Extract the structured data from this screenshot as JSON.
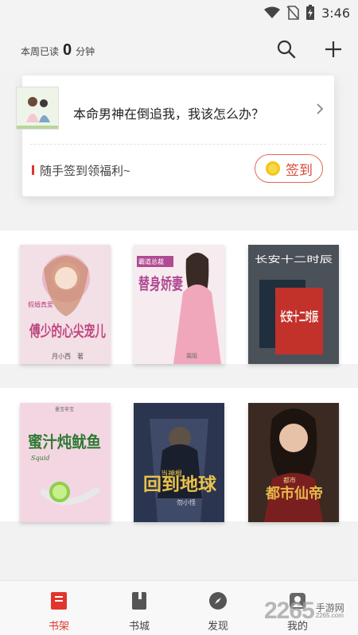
{
  "status_bar": {
    "time": "3:46",
    "icons": [
      "wifi-icon",
      "no-sim-icon",
      "battery-charging-icon"
    ]
  },
  "header": {
    "week_read_prefix": "本周已读",
    "week_read_minutes": "0",
    "week_read_suffix": "分钟",
    "icons": [
      "search-icon",
      "add-icon"
    ]
  },
  "recommendation": {
    "title": "本命男神在倒追我，我该怎么办？"
  },
  "signin": {
    "text": "随手签到领福利~",
    "button_label": "签到"
  },
  "books": [
    {
      "title": "傅少的心尖宠儿",
      "subtitle": "假婚真爱",
      "author": "月小西",
      "author_suffix": "著",
      "bg": "#f3dfe6",
      "accent": "#c0457e"
    },
    {
      "title": "替身娇妻",
      "subtitle": "霸道总裁",
      "author": "裴陌",
      "author_suffix": "",
      "bg": "#f6ecef",
      "accent": "#b04a92"
    },
    {
      "title": "长安十二时辰",
      "subtitle": "长安十二时辰",
      "author": "",
      "author_suffix": "",
      "bg": "#4b5159",
      "accent": "#d0392f"
    },
    {
      "title": "蜜汁炖鱿鱼",
      "subtitle": "Squid",
      "author": "墨宝非宝",
      "author_suffix": "",
      "bg": "#f4d6e2",
      "accent": "#3a8b3a"
    },
    {
      "title": "回到地球",
      "subtitle": "当神棍",
      "author": "勿小怪",
      "author_suffix": "",
      "bg": "#2c3550",
      "accent": "#e8c24a"
    },
    {
      "title": "都市仙帝",
      "subtitle": "都市",
      "author": "",
      "author_suffix": "",
      "bg": "#3a2a22",
      "accent": "#e6b84a"
    }
  ],
  "nav": [
    {
      "label": "书架",
      "icon": "bookshelf-icon",
      "active": true
    },
    {
      "label": "书城",
      "icon": "bookstore-icon",
      "active": false
    },
    {
      "label": "发现",
      "icon": "compass-icon",
      "active": false
    },
    {
      "label": "我的",
      "icon": "profile-icon",
      "active": false
    }
  ],
  "watermark": {
    "number": "2265",
    "caption_cn": "手游网",
    "caption_url": "2265.com"
  },
  "colors": {
    "accent": "#e0352b",
    "signin_border": "#e06a52",
    "coin": "#f5c518",
    "background": "#f2f2f2"
  }
}
